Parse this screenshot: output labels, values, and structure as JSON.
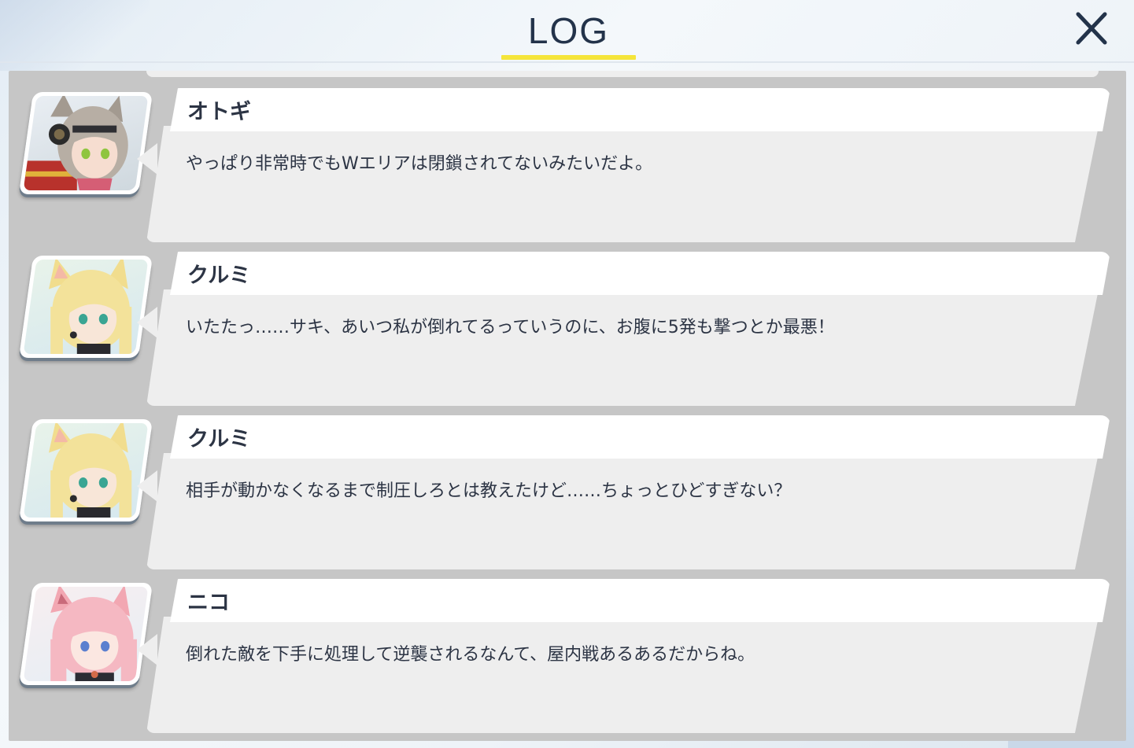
{
  "header": {
    "title": "LOG",
    "accent_color": "#f5e53a",
    "close_icon": "close-icon"
  },
  "log": {
    "entries": [
      {
        "speaker": "オトギ",
        "message": "やっぱり非常時でもWエリアは閉鎖されてないみたいだよ。",
        "avatar": "otogi-avatar"
      },
      {
        "speaker": "クルミ",
        "message": "いたたっ……サキ、あいつ私が倒れてるっていうのに、お腹に5発も撃つとか最悪！",
        "avatar": "kurumi-avatar"
      },
      {
        "speaker": "クルミ",
        "message": "相手が動かなくなるまで制圧しろとは教えたけど……ちょっとひどすぎない？",
        "avatar": "kurumi-avatar"
      },
      {
        "speaker": "ニコ",
        "message": "倒れた敵を下手に処理して逆襲されるなんて、屋内戦あるあるだからね。",
        "avatar": "niko-avatar"
      }
    ]
  }
}
